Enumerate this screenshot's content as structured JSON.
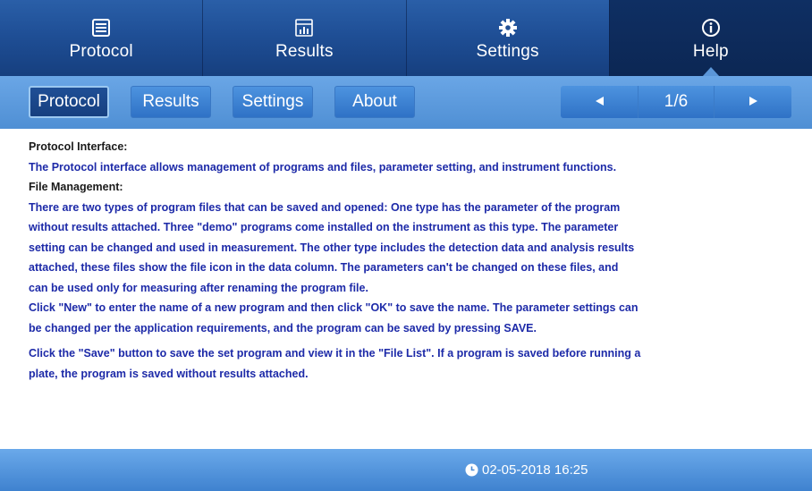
{
  "topnav": {
    "tabs": [
      {
        "label": "Protocol",
        "icon": "monitor-icon"
      },
      {
        "label": "Results",
        "icon": "bar-chart-icon"
      },
      {
        "label": "Settings",
        "icon": "gear-icon"
      },
      {
        "label": "Help",
        "icon": "info-icon"
      }
    ],
    "active": "Help"
  },
  "subnav": {
    "buttons": [
      "Protocol",
      "Results",
      "Settings",
      "About"
    ],
    "active": "Protocol",
    "pager": {
      "page": "1/6",
      "prev_icon": "triangle-left-icon",
      "next_icon": "triangle-right-icon"
    }
  },
  "content": {
    "heading1": "Protocol Interface:",
    "para1": "The Protocol interface allows management of programs and files, parameter setting, and instrument functions.",
    "heading2": "File Management:",
    "lines": [
      "There are two types of program files that can be saved and opened: One type has the parameter of the program",
      "without results attached.  Three \"demo\" programs come installed on the instrument as this type.  The parameter",
      "setting can be changed and used in measurement.  The other type includes the detection data and analysis results",
      "attached, these files show the file icon in the data column.  The parameters can't be changed on these files, and",
      "can be used only for measuring after renaming the program file.",
      "Click \"New\" to enter the name of a new program and then click \"OK\" to save the name.  The parameter settings can",
      "be changed per the application requirements, and the program can be saved by pressing SAVE."
    ],
    "lines2": [
      "Click the \"Save\" button to save the set program and view it in the \"File List\".  If a program is saved before running a",
      "plate, the program is saved without results attached."
    ]
  },
  "footer": {
    "datetime": "02-05-2018 16:25",
    "clock_icon": "clock-icon"
  },
  "colors": {
    "nav_dark": "#1f4f96",
    "nav_light": "#5b96d8",
    "body_text": "#1d2aa8",
    "heading_text": "#1a1a1a"
  }
}
